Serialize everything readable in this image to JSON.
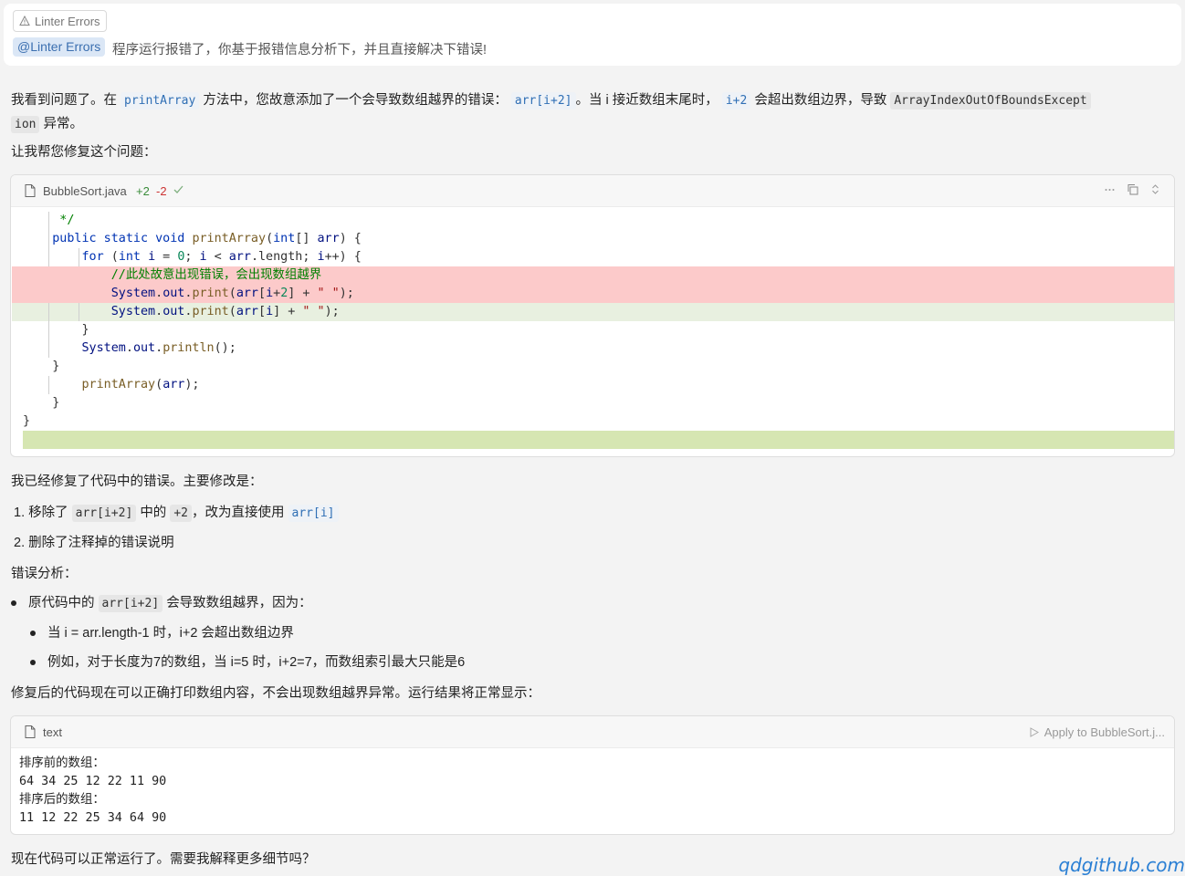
{
  "user_message": {
    "context_tag": "Linter Errors",
    "mention": "@Linter Errors",
    "text": "程序运行报错了，你基于报错信息分析下，并且直接解决下错误!"
  },
  "reply": {
    "intro_1": "我看到问题了。在",
    "code_printArray": "printArray",
    "intro_2": "方法中，您故意添加了一个会导致数组越界的错误：",
    "code_arr_i2": "arr[i+2]",
    "intro_3": "。当 i 接近数组末尾时，",
    "code_i2": "i+2",
    "intro_4": "会超出数组边界，导致",
    "code_exception_a": "ArrayIndexOutOfBoundsExcept",
    "code_exception_b": "ion",
    "intro_5": "异常。",
    "help": "让我帮您修复这个问题：",
    "fixed": "我已经修复了代码中的错误。主要修改是：",
    "list_1a": "1. 移除了",
    "list_1_code1": "arr[i+2]",
    "list_1b": "中的",
    "list_1_code2": "+2",
    "list_1c": "，改为直接使用",
    "list_1_code3": "arr[i]",
    "list_2": "2. 删除了注释掉的错误说明",
    "analysis": "错误分析：",
    "bullet_1a": "原代码中的",
    "bullet_1_code": "arr[i+2]",
    "bullet_1b": "会导致数组越界，因为：",
    "bullet_2": "当 i = arr.length-1 时，i+2 会超出数组边界",
    "bullet_3": "例如，对于长度为7的数组，当 i=5 时，i+2=7，而数组索引最大只能是6",
    "after": "修复后的代码现在可以正确打印数组内容，不会出现数组越界异常。运行结果将正常显示：",
    "closing": "现在代码可以正常运行了。需要我解释更多细节吗？"
  },
  "code_block": {
    "file_name": "BubbleSort.java",
    "additions": "+2",
    "deletions": "-2",
    "icons": [
      "file-icon",
      "check-icon",
      "more-icon",
      "copy-icon",
      "expand-icon"
    ],
    "lines": {
      "l1": " */",
      "l3_for": "for",
      "l4_comment": "//此处故意出现错误，会出现数组越界",
      "l6_indent": "        "
    }
  },
  "output_block": {
    "lang": "text",
    "apply_label": "Apply to BubbleSort.j...",
    "lines": [
      "排序前的数组：",
      "64 34 25 12 22 11 90",
      "排序后的数组：",
      "11 12 22 25 34 64 90"
    ]
  },
  "watermark": "qdgithub.com",
  "colors": {
    "deleted_bg": "#fccaca",
    "added_bg": "#e8f0e0",
    "mention_bg": "#dbe7f6"
  }
}
